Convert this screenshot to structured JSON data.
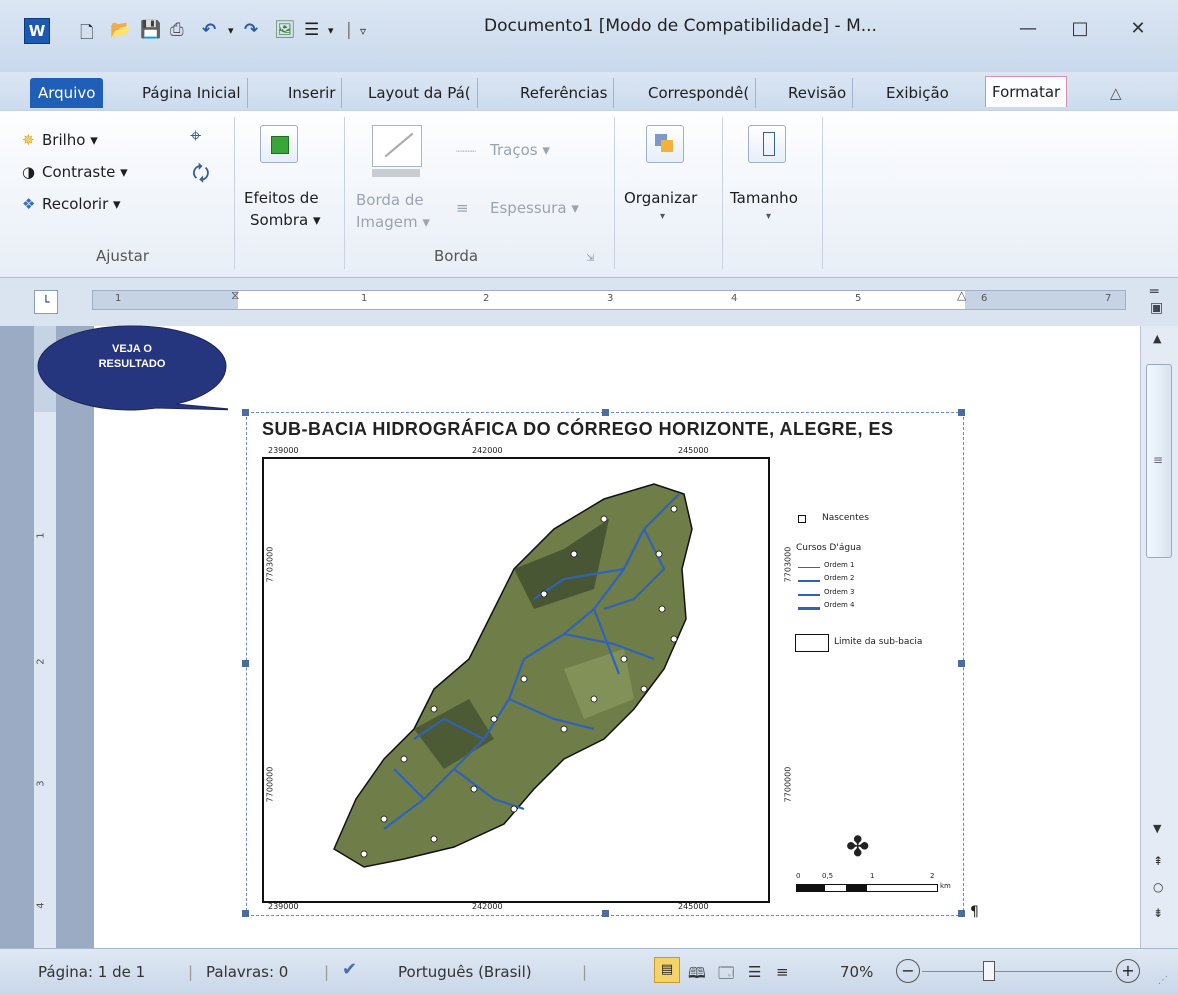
{
  "window": {
    "app_icon": "W",
    "title": "Documento1 [Modo de Compatibilidade] - M...",
    "quick_access": [
      "new-icon",
      "open-icon",
      "save-icon",
      "print-icon",
      "undo-icon",
      "dropdown-icon",
      "redo-icon",
      "image-icon",
      "list-icon",
      "customize-icon"
    ]
  },
  "tabs": [
    {
      "label": "Arquivo"
    },
    {
      "label": "Página Inicial"
    },
    {
      "label": "Inserir"
    },
    {
      "label": "Layout da Pá("
    },
    {
      "label": "Referências"
    },
    {
      "label": "Correspondê("
    },
    {
      "label": "Revisão"
    },
    {
      "label": "Exibição"
    },
    {
      "label": "Formatar"
    }
  ],
  "ribbon": {
    "ajustar": {
      "brilho": "Brilho",
      "contraste": "Contraste",
      "recolorir": "Recolorir",
      "label": "Ajustar"
    },
    "sombra": {
      "line1": "Efeitos de",
      "line2": "Sombra"
    },
    "borda": {
      "borda1": "Borda de",
      "borda2": "Imagem",
      "tracos": "Traços",
      "espessura": "Espessura",
      "label": "Borda"
    },
    "organizar": "Organizar",
    "tamanho": "Tamanho"
  },
  "ruler": {
    "marks": [
      "1",
      "1",
      "2",
      "3",
      "4",
      "5",
      "6",
      "7"
    ]
  },
  "callout": {
    "line1": "VEJA O",
    "line2": "RESULTADO"
  },
  "map": {
    "title": "SUB-BACIA HIDROGRÁFICA DO CÓRREGO HORIZONTE, ALEGRE, ES",
    "coords_top": [
      "239000",
      "242000",
      "245000"
    ],
    "coords_bottom": [
      "239000",
      "242000",
      "245000"
    ],
    "coords_left": [
      "7703000",
      "7700000"
    ],
    "legend": {
      "nascentes": "Nascentes",
      "cursos": "Cursos D'água",
      "orders": [
        "Ordem 1",
        "Ordem 2",
        "Ordem 3",
        "Ordem 4"
      ],
      "limite": "Limite da sub-bacia",
      "scale_labels": [
        "0",
        "0,5",
        "1",
        "2"
      ],
      "scale_unit": "km"
    }
  },
  "status": {
    "page": "Página: 1 de 1",
    "words": "Palavras: 0",
    "language": "Português (Brasil)",
    "zoom": "70%",
    "zoom_level": 0.7
  }
}
